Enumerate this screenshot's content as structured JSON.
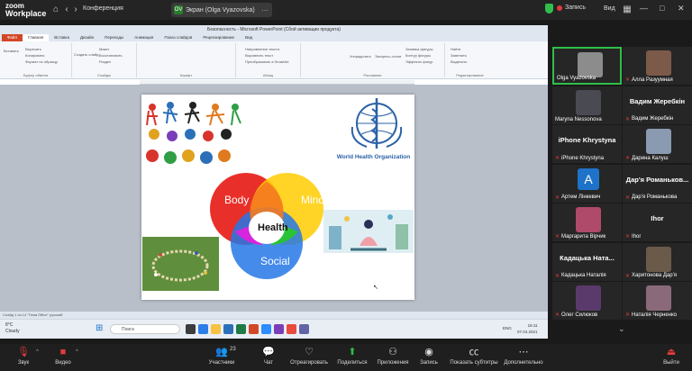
{
  "zoom": {
    "logo_line1": "zoom",
    "logo_line2": "Workplace",
    "conference_label": "Конференция",
    "screen_badge": "OV",
    "screen_label": "Экран (Olga Vyazovska)",
    "recording_label": "Запись",
    "view_label": "Вид"
  },
  "ppt": {
    "window_title": "Безопасность - Microsoft PowerPoint (Сбой активации продукта)",
    "tabs": [
      "Файл",
      "Главная",
      "Вставка",
      "Дизайн",
      "Переходы",
      "Анимация",
      "Показ слайдов",
      "Рецензирование",
      "Вид"
    ],
    "ribbon": {
      "paste": "Вставить",
      "cut": "Вырезать",
      "copy": "Копировать",
      "format": "Формат по образцу",
      "clipboard_group": "Буфер обмена",
      "create_slide": "Создать слайд",
      "layout": "Макет",
      "reset": "Восстановить",
      "section": "Раздел",
      "slides_group": "Слайды",
      "font_group": "Шрифт",
      "text_direction": "Направление текста",
      "align_text": "Выровнять текст",
      "smartart": "Преобразовать в SmartArt",
      "paragraph_group": "Абзац",
      "arrange": "Упорядочить",
      "quick_styles": "Экспресс-стили",
      "shape_fill": "Заливка фигуры",
      "shape_outline": "Контур фигуры",
      "shape_effects": "Эффекты фигур",
      "drawing_group": "Рисование",
      "find": "Найти",
      "replace": "Заменить",
      "select": "Выделить",
      "editing_group": "Редактирование"
    },
    "slide": {
      "who_text": "World Health Organization",
      "venn": {
        "body": "Body",
        "mind": "Mind",
        "health": "Health",
        "social": "Social"
      }
    },
    "statusbar": "Слайд 1 из 14   \"Тема Office\"   русский"
  },
  "taskbar": {
    "weather_temp": "8°C",
    "weather_desc": "Cloudy",
    "search_placeholder": "Поиск",
    "lang": "ENG",
    "time": "16:11",
    "date": "07.04.2021"
  },
  "participants": [
    {
      "name": "Olga Vyazovska",
      "big": "",
      "muted": false,
      "kind": "photo",
      "color": "#8c8c8c",
      "active": true
    },
    {
      "name": "Алла Разуумная",
      "big": "",
      "muted": true,
      "kind": "photo",
      "color": "#7b5a4a"
    },
    {
      "name": "Maryna Nessonova",
      "big": "",
      "muted": false,
      "kind": "photo",
      "color": "#4a4a52"
    },
    {
      "name": "Вадим Жеребкін",
      "big": "Вадим Жеребкін",
      "muted": true,
      "kind": "text"
    },
    {
      "name": "iPhone Khrystyna",
      "big": "iPhone Khrystyna",
      "muted": true,
      "kind": "text"
    },
    {
      "name": "Дарина Калуш",
      "big": "",
      "muted": true,
      "kind": "photo",
      "color": "#8a9ab0"
    },
    {
      "name": "Артем Лінкевич",
      "big": "",
      "muted": true,
      "kind": "avatar",
      "letter": "A"
    },
    {
      "name": "Дар'я Романькова",
      "big": "Дар'я  Романьков...",
      "muted": true,
      "kind": "text"
    },
    {
      "name": "Маргарита Вірчик",
      "big": "",
      "muted": true,
      "kind": "photo",
      "color": "#b04a6a"
    },
    {
      "name": "Ihor",
      "big": "Ihor",
      "muted": true,
      "kind": "text"
    },
    {
      "name": "Кадацька Наталія",
      "big": "Кадацька  Ната...",
      "muted": true,
      "kind": "text"
    },
    {
      "name": "Харитонова Дар'я",
      "big": "",
      "muted": true,
      "kind": "photo",
      "color": "#6a5a4a"
    },
    {
      "name": "Олег Силюков",
      "big": "",
      "muted": true,
      "kind": "photo",
      "color": "#5a3a6a"
    },
    {
      "name": "Наталія Черненко",
      "big": "",
      "muted": true,
      "kind": "photo",
      "color": "#8a6a7a"
    }
  ],
  "controls": {
    "audio": "Звук",
    "video": "Видео",
    "participants": "Участники",
    "participants_count": "23",
    "chat": "Чат",
    "react": "Отреагировать",
    "share": "Поделиться",
    "apps": "Приложения",
    "record": "Запись",
    "captions": "Показать субтитры",
    "more": "Дополнительно",
    "leave": "Выйти"
  }
}
